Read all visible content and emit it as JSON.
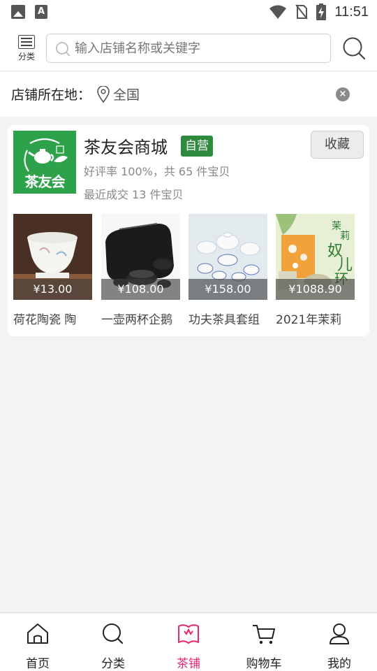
{
  "status_bar": {
    "time": "11:51",
    "icons": [
      "image-icon",
      "a-font-icon",
      "wifi-icon",
      "no-sim-icon",
      "battery-charging-icon"
    ]
  },
  "header": {
    "category_label": "分类",
    "search_placeholder": "输入店铺名称或关键字"
  },
  "location": {
    "label": "店铺所在地：",
    "value": "全国"
  },
  "shop": {
    "logo_text": "茶友会",
    "name": "茶友会商城",
    "badge": "自营",
    "favorite_label": "收藏",
    "rating_text": "好评率 100%，共 65 件宝贝",
    "sales_text": "最近成交 13 件宝贝",
    "products": [
      {
        "price": "¥13.00",
        "title": "荷花陶瓷 陶"
      },
      {
        "price": "¥108.00",
        "title": "一壶两杯企鹅"
      },
      {
        "price": "¥158.00",
        "title": "功夫茶具套组"
      },
      {
        "price": "¥1088.90",
        "title": "2021年茉莉"
      }
    ]
  },
  "bottom_nav": {
    "items": [
      {
        "label": "首页",
        "icon": "home-icon"
      },
      {
        "label": "分类",
        "icon": "category-search-icon"
      },
      {
        "label": "茶铺",
        "icon": "shop-book-icon",
        "active": true
      },
      {
        "label": "购物车",
        "icon": "cart-icon"
      },
      {
        "label": "我的",
        "icon": "user-icon"
      }
    ],
    "active_color": "#e8266f"
  },
  "colors": {
    "badge_green": "#2e8a3c",
    "logo_green": "#2ea24a"
  }
}
